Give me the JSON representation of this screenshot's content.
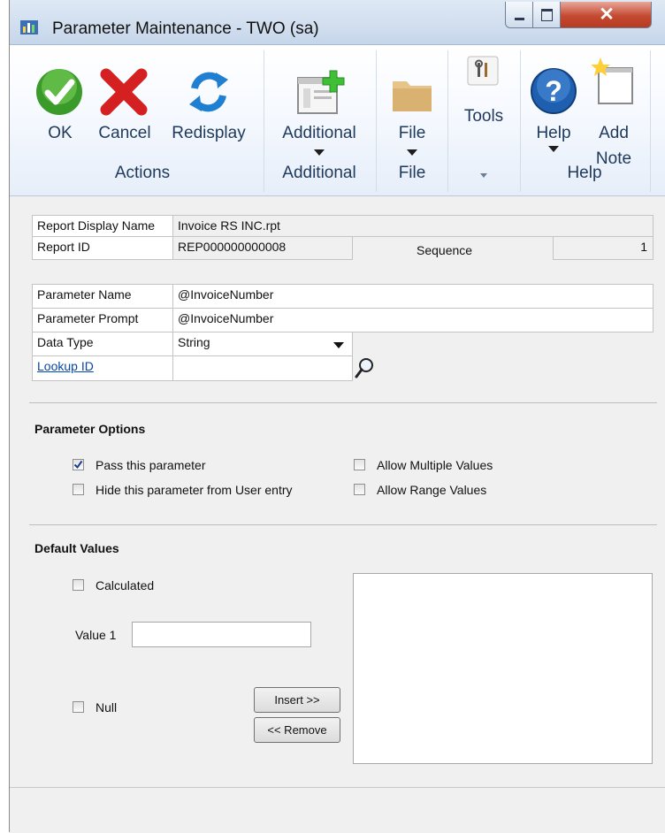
{
  "window": {
    "title": "Parameter Maintenance  -  TWO (sa)"
  },
  "ribbon": {
    "buttons": {
      "ok": "OK",
      "cancel": "Cancel",
      "redisplay": "Redisplay",
      "additional": "Additional",
      "file": "File",
      "tools": "Tools",
      "help": "Help",
      "add_note_line1": "Add",
      "add_note_line2": "Note"
    },
    "groups": {
      "actions": "Actions",
      "additional": "Additional",
      "file": "File",
      "help": "Help"
    }
  },
  "report": {
    "display_name_label": "Report Display Name",
    "display_name_value": "Invoice RS INC.rpt",
    "id_label": "Report ID",
    "id_value": "REP000000000008",
    "sequence_label": "Sequence",
    "sequence_value": "1"
  },
  "parameter": {
    "name_label": "Parameter Name",
    "name_value": "@InvoiceNumber",
    "prompt_label": "Parameter Prompt",
    "prompt_value": "@InvoiceNumber",
    "data_type_label": "Data Type",
    "data_type_value": "String",
    "lookup_label": "Lookup ID",
    "lookup_value": ""
  },
  "options": {
    "title": "Parameter Options",
    "pass": {
      "label": "Pass this parameter",
      "checked": true
    },
    "hide": {
      "label": "Hide this parameter from User entry",
      "checked": false
    },
    "multiple": {
      "label": "Allow Multiple Values",
      "checked": false
    },
    "range": {
      "label": "Allow Range Values",
      "checked": false
    }
  },
  "defaults": {
    "title": "Default Values",
    "calculated": {
      "label": "Calculated",
      "checked": false
    },
    "value1_label": "Value 1",
    "value1": "",
    "null": {
      "label": "Null",
      "checked": false
    },
    "insert_label": "Insert >>",
    "remove_label": "<< Remove"
  },
  "colors": {
    "link": "#0645ad",
    "ribbon_text": "#1e395b",
    "ok_green": "#3a9b2a",
    "cancel_red": "#d42020",
    "redisplay_blue": "#1f7fd1",
    "help_blue": "#1e5fb0"
  }
}
